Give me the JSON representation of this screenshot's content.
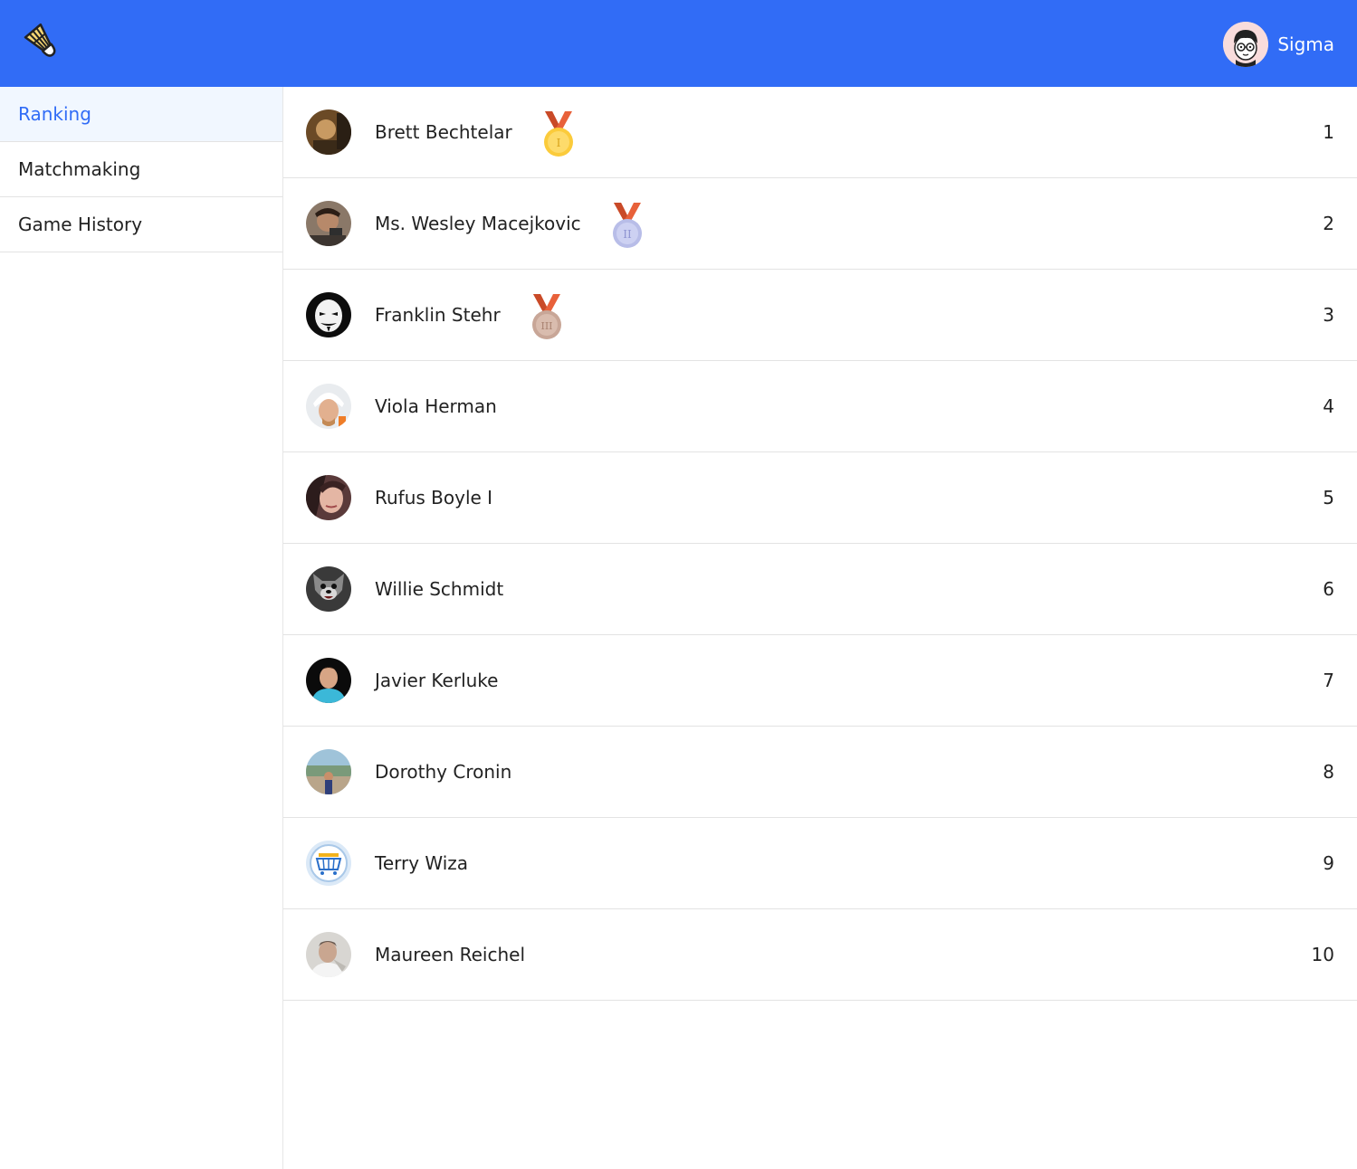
{
  "app": {
    "logo_icon": "shuttlecock-icon",
    "accent_color": "#316cf6"
  },
  "user": {
    "name": "Sigma",
    "avatar_icon": "cartoon-face-glasses-icon"
  },
  "sidebar": {
    "items": [
      {
        "label": "Ranking",
        "active": true
      },
      {
        "label": "Matchmaking",
        "active": false
      },
      {
        "label": "Game History",
        "active": false
      }
    ]
  },
  "ranking": {
    "players": [
      {
        "name": "Brett Bechtelar",
        "rank": "1",
        "medal": "gold-medal-icon"
      },
      {
        "name": "Ms. Wesley Macejkovic",
        "rank": "2",
        "medal": "silver-medal-icon"
      },
      {
        "name": "Franklin Stehr",
        "rank": "3",
        "medal": "bronze-medal-icon"
      },
      {
        "name": "Viola Herman",
        "rank": "4"
      },
      {
        "name": "Rufus Boyle I",
        "rank": "5"
      },
      {
        "name": "Willie Schmidt",
        "rank": "6"
      },
      {
        "name": "Javier Kerluke",
        "rank": "7"
      },
      {
        "name": "Dorothy Cronin",
        "rank": "8"
      },
      {
        "name": "Terry Wiza",
        "rank": "9"
      },
      {
        "name": "Maureen Reichel",
        "rank": "10"
      }
    ]
  }
}
